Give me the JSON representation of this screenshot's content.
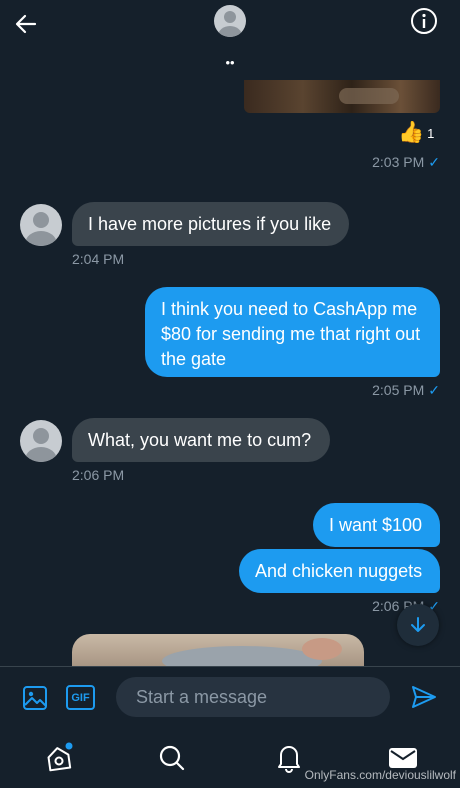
{
  "header": {
    "back_icon": "arrow-left-icon",
    "info_icon": "info-icon",
    "dots": "••"
  },
  "reaction": {
    "emoji": "👍",
    "count": "1"
  },
  "messages": [
    {
      "dir": "out-meta",
      "time": "2:03 PM",
      "status": "✓"
    },
    {
      "dir": "in",
      "text": "I have more pictures if you like",
      "time": "2:04 PM"
    },
    {
      "dir": "out",
      "text": "I think you need to CashApp me $80 for sending me that right out the gate",
      "time": "2:05 PM",
      "status": "✓"
    },
    {
      "dir": "in",
      "text": "What, you want me to cum?",
      "time": "2:06 PM"
    },
    {
      "dir": "out",
      "text": "I want $100"
    },
    {
      "dir": "out",
      "text": "And chicken nuggets",
      "time": "2:06 PM",
      "status": "✓"
    }
  ],
  "composer": {
    "placeholder": "Start a message",
    "gif_label": "GIF"
  },
  "bottom_nav": {
    "items": [
      "home-icon",
      "search-icon",
      "notifications-icon",
      "messages-icon"
    ]
  },
  "watermark": "OnlyFans.com/deviouslilwolf",
  "colors": {
    "background": "#15202b",
    "accent": "#1d9bf0",
    "incoming_bubble": "#3a444c"
  }
}
